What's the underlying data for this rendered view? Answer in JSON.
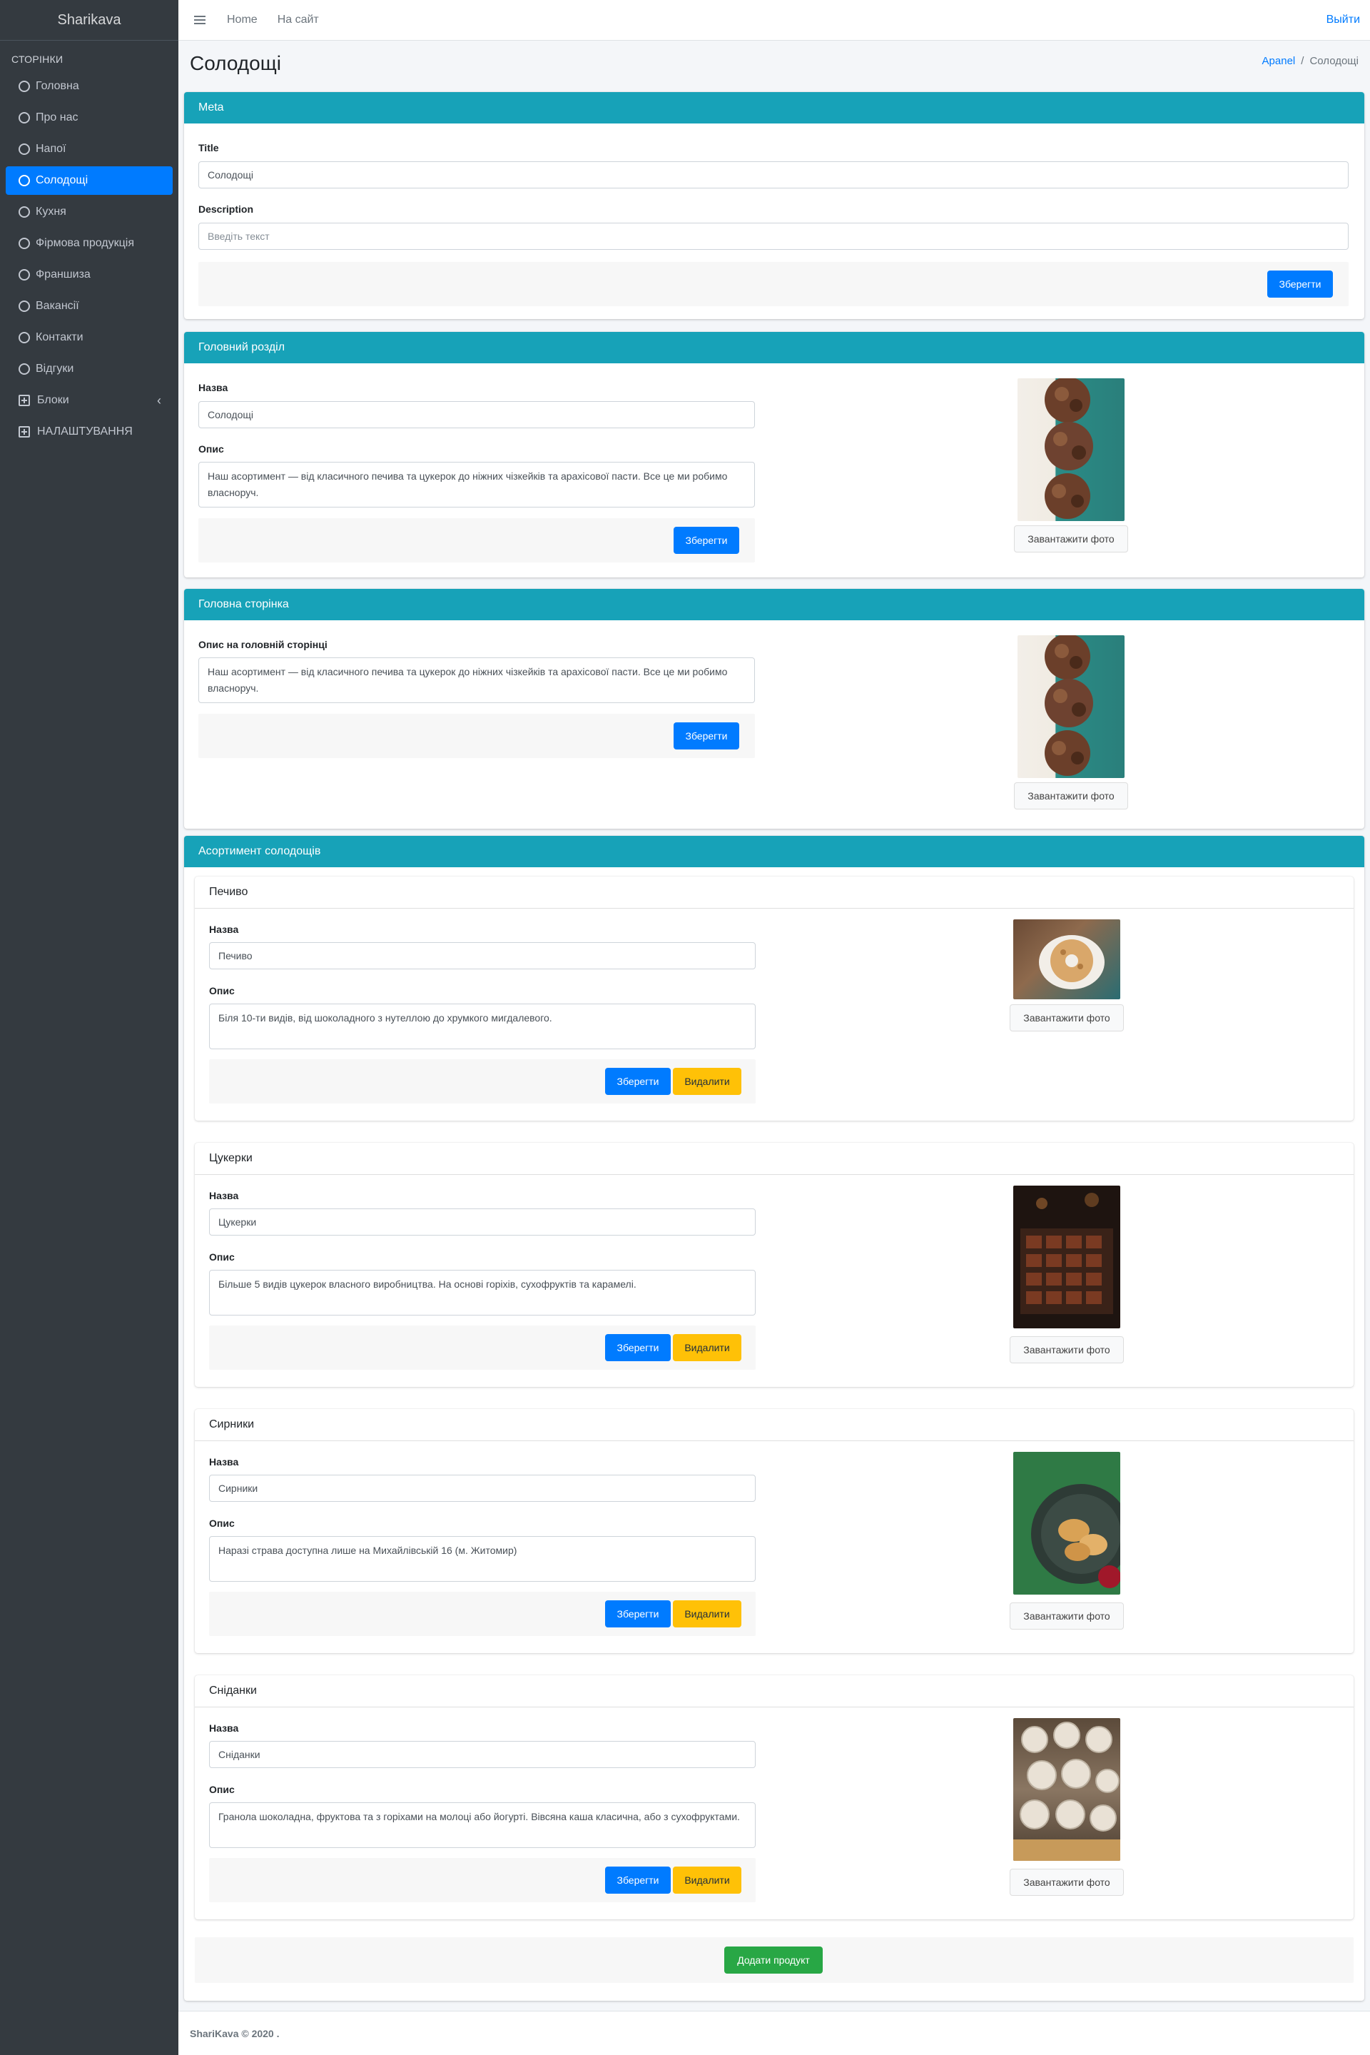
{
  "sidebar": {
    "brand": "Sharikava",
    "header": "СТОРІНКИ",
    "items": [
      {
        "label": "Головна"
      },
      {
        "label": "Про нас"
      },
      {
        "label": "Напої"
      },
      {
        "label": "Солодощі"
      },
      {
        "label": "Кухня"
      },
      {
        "label": "Фірмова продукція"
      },
      {
        "label": "Франшиза"
      },
      {
        "label": "Вакансії"
      },
      {
        "label": "Контакти"
      },
      {
        "label": "Відгуки"
      },
      {
        "label": "Блоки"
      },
      {
        "label": "НАЛАШТУВАННЯ"
      }
    ]
  },
  "topnav": {
    "home": "Home",
    "site": "На сайт",
    "logout": "Выйти"
  },
  "page": {
    "title": "Солодощі"
  },
  "breadcrumb": {
    "root": "Apanel",
    "sep": "/",
    "current": "Солодощі"
  },
  "meta": {
    "header": "Meta",
    "title_label": "Title",
    "title_value": "Солодощі",
    "description_label": "Description",
    "description_placeholder": "Введіть текст",
    "save": "Зберегти"
  },
  "main_section": {
    "header": "Головний розділ",
    "name_label": "Назва",
    "name_value": "Солодощі",
    "desc_label": "Опис",
    "desc_value": "Наш асортимент — від класичного печива та цукерок до ніжних чізкейків та арахісової пасти. Все це ми робимо власноруч.",
    "save": "Зберегти",
    "upload": "Завантажити фото"
  },
  "home_page": {
    "header": "Головна сторінка",
    "desc_label": "Опис на головній сторінці",
    "desc_value": "Наш асортимент — від класичного печива та цукерок до ніжних чізкейків та арахісової пасти. Все це ми робимо власноруч.",
    "save": "Зберегти",
    "upload": "Завантажити фото"
  },
  "assortment": {
    "header": "Асортимент солодощів",
    "add": "Додати продукт",
    "items": [
      {
        "title": "Печиво",
        "name_label": "Назва",
        "name": "Печиво",
        "desc_label": "Опис",
        "desc": "Біля 10-ти видів, від шоколадного з нутеллою до хрумкого мигдалевого.",
        "save": "Зберегти",
        "delete": "Видалити",
        "upload": "Завантажити фото"
      },
      {
        "title": "Цукерки",
        "name_label": "Назва",
        "name": "Цукерки",
        "desc_label": "Опис",
        "desc": "Більше 5 видів цукерок власного виробництва. На основі горіхів, сухофруктів та карамелі.",
        "save": "Зберегти",
        "delete": "Видалити",
        "upload": "Завантажити фото"
      },
      {
        "title": "Сирники",
        "name_label": "Назва",
        "name": "Сирники",
        "desc_label": "Опис",
        "desc": "Наразі страва доступна лише на Михайлівській 16 (м. Житомир)",
        "save": "Зберегти",
        "delete": "Видалити",
        "upload": "Завантажити фото"
      },
      {
        "title": "Сніданки",
        "name_label": "Назва",
        "name": "Сніданки",
        "desc_label": "Опис",
        "desc": "Гранола шоколадна, фруктова та з горіхами на молоці або йогурті. Вівсяна каша класична, або з сухофруктами.",
        "save": "Зберегти",
        "delete": "Видалити",
        "upload": "Завантажити фото"
      }
    ]
  },
  "footer": {
    "text": "ShariKava © 2020 ."
  }
}
